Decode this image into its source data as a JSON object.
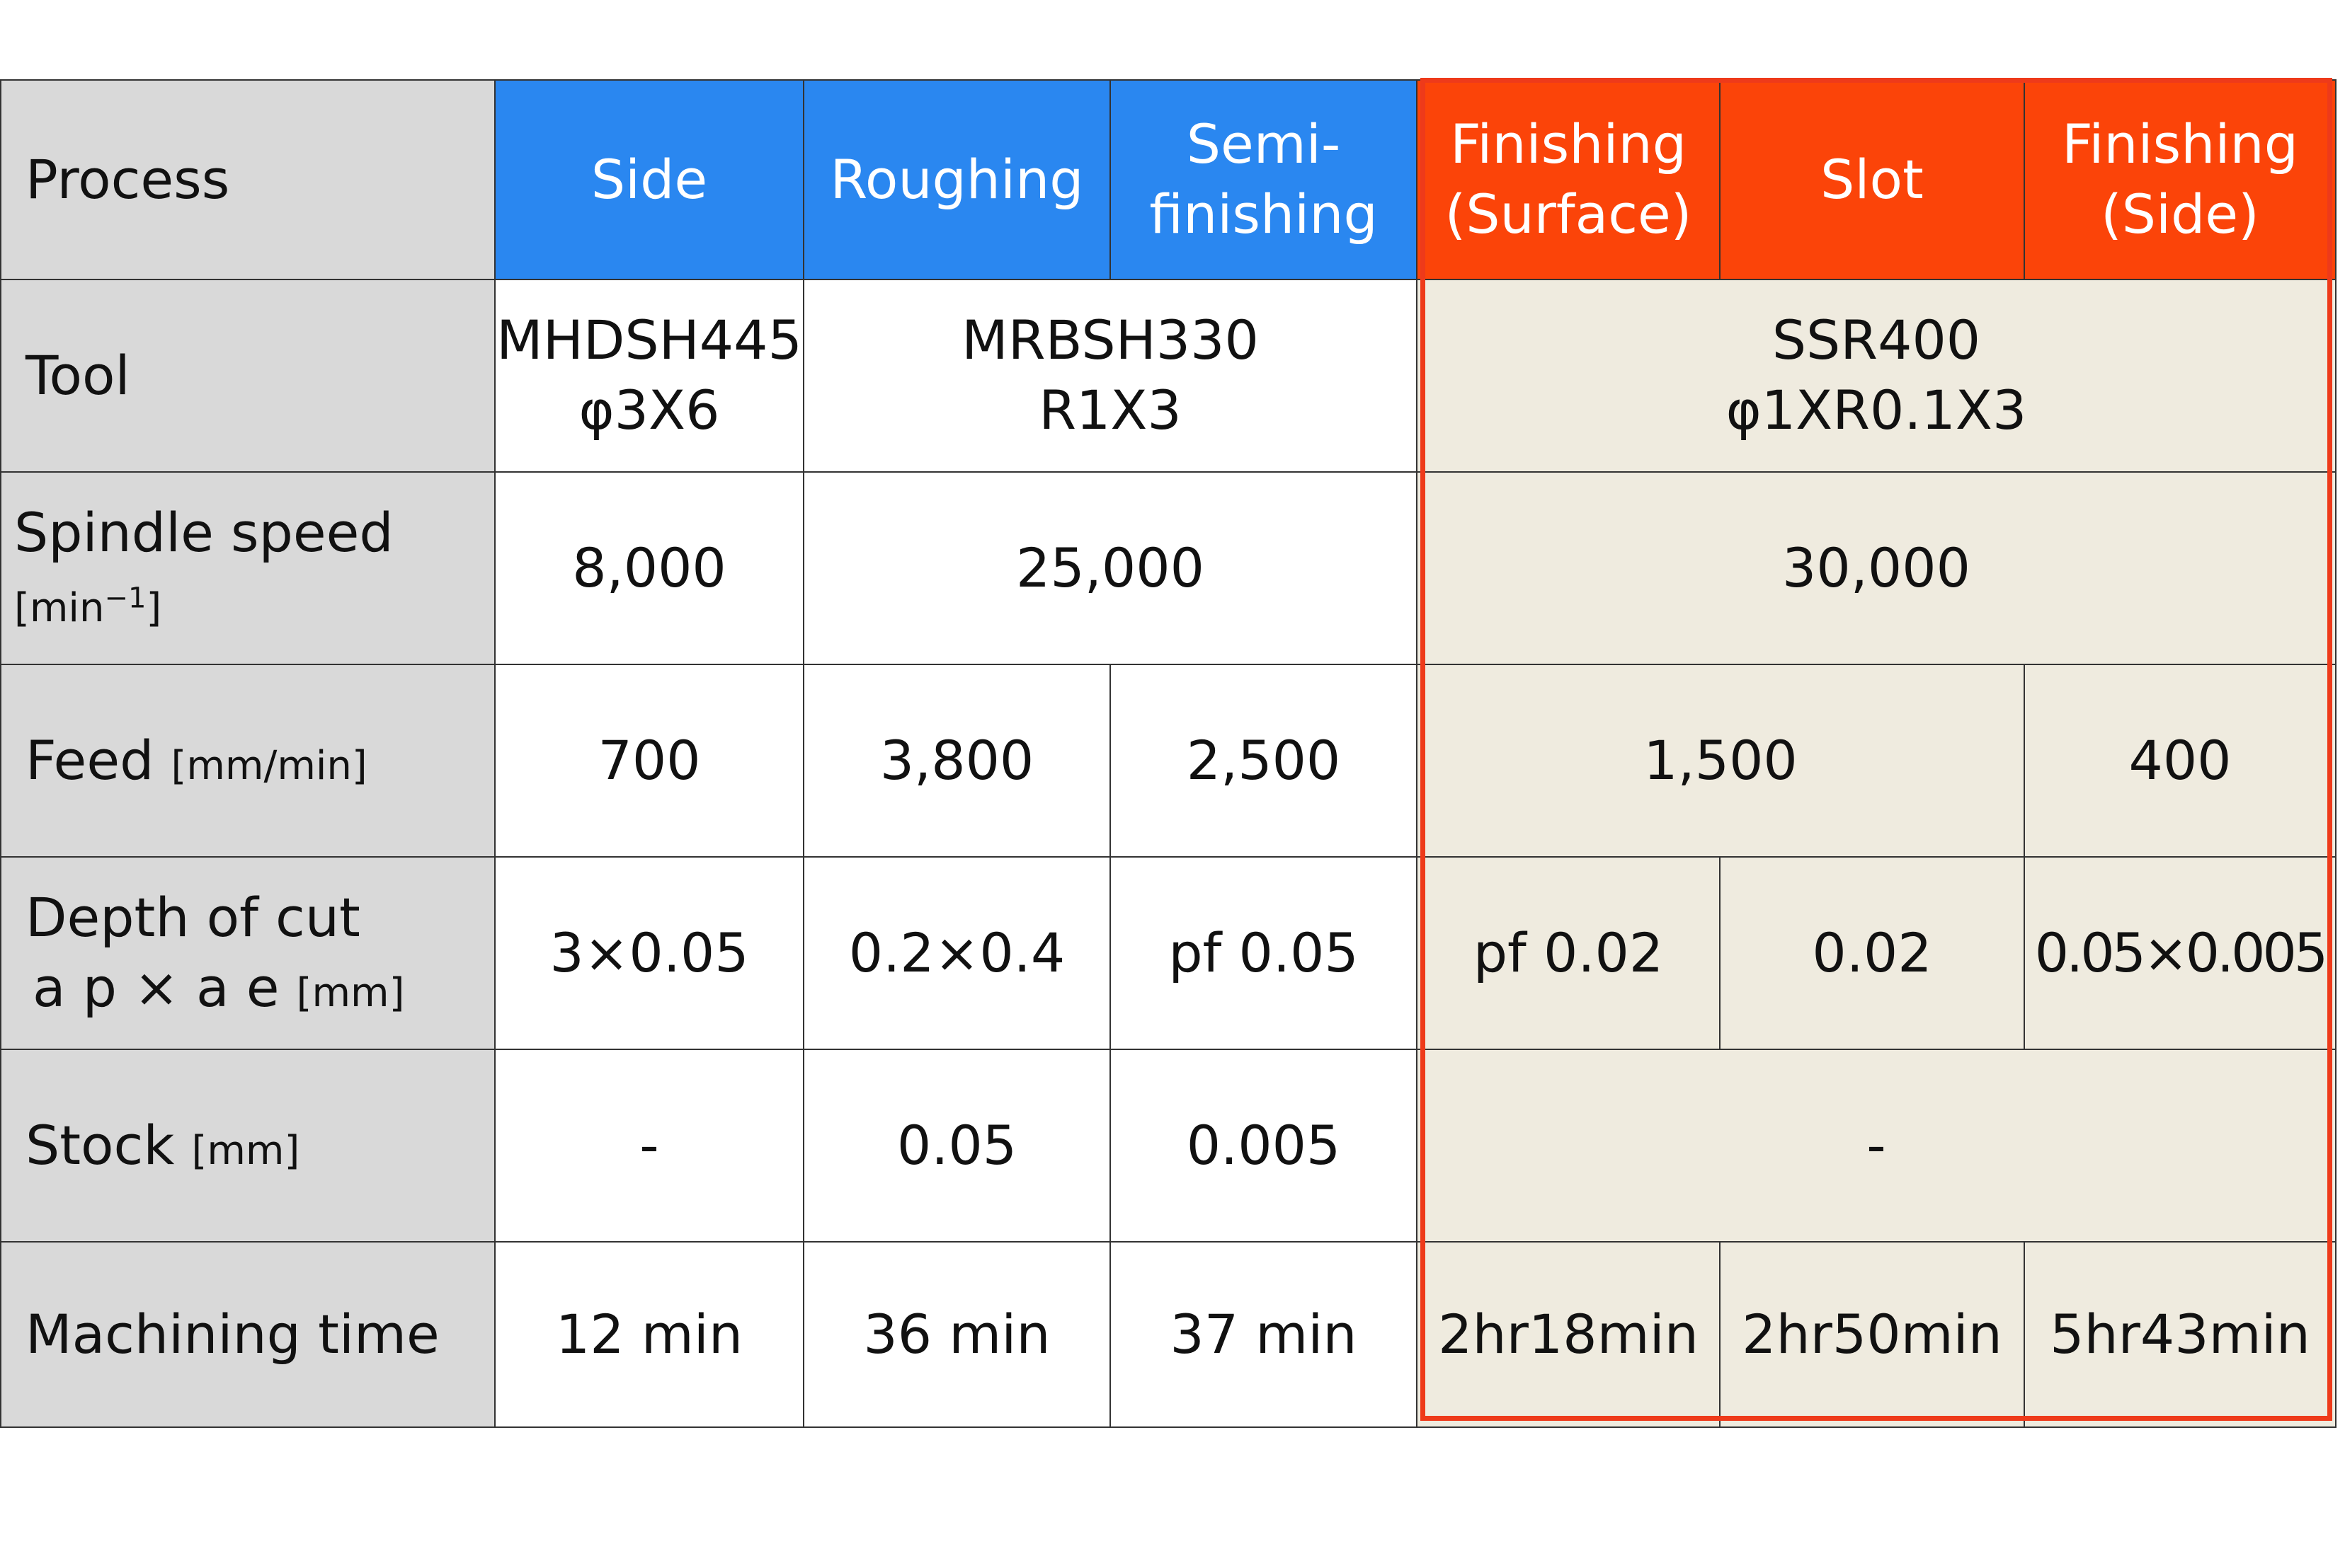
{
  "table": {
    "header": {
      "process": "Process",
      "side": "Side",
      "roughing": "Roughing",
      "semi_finishing_1": "Semi-",
      "semi_finishing_2": "finishing",
      "finishing_surface_1": "Finishing",
      "finishing_surface_2": "(Surface)",
      "slot": "Slot",
      "finishing_side_1": "Finishing",
      "finishing_side_2": "(Side)"
    },
    "tool": {
      "label": "Tool",
      "side_1": "MHDSH445",
      "side_2": "φ3X6",
      "rough_semi_1": "MRBSH330",
      "rough_semi_2": "R1X3",
      "finishing_1": "SSR400",
      "finishing_2": "φ1XR0.1X3"
    },
    "spindle": {
      "label": "Spindle speed",
      "unit_prefix": "[min",
      "unit_sup": "−1",
      "unit_suffix": "]",
      "side": "8,000",
      "rough_semi": "25,000",
      "finishing": "30,000"
    },
    "feed": {
      "label": "Feed",
      "unit": "[mm/min]",
      "side": "700",
      "roughing": "3,800",
      "semi_finishing": "2,500",
      "finishing_surface_slot": "1,500",
      "finishing_side": "400"
    },
    "depth": {
      "label_1": "Depth of cut",
      "label_2": "a p ×  a e",
      "unit": "[mm]",
      "side": "3×0.05",
      "roughing": "0.2×0.4",
      "semi_finishing": "pf 0.05",
      "finishing_surface": "pf 0.02",
      "slot": "0.02",
      "finishing_side": "0.05×0.005"
    },
    "stock": {
      "label": "Stock",
      "unit": "[mm]",
      "side": "-",
      "roughing": "0.05",
      "semi_finishing": "0.005",
      "finishing": "-"
    },
    "time": {
      "label": "Machining time",
      "side": "12 min",
      "roughing": "36 min",
      "semi_finishing": "37 min",
      "finishing_surface": "2hr18min",
      "slot": "2hr50min",
      "finishing_side": "5hr43min"
    }
  },
  "colors": {
    "blue_header": "#2a87f0",
    "red_header": "#fb4409",
    "label_gray": "#d9d9d9",
    "finishing_beige": "#efebdf",
    "highlight_frame": "#ee3a1a"
  }
}
